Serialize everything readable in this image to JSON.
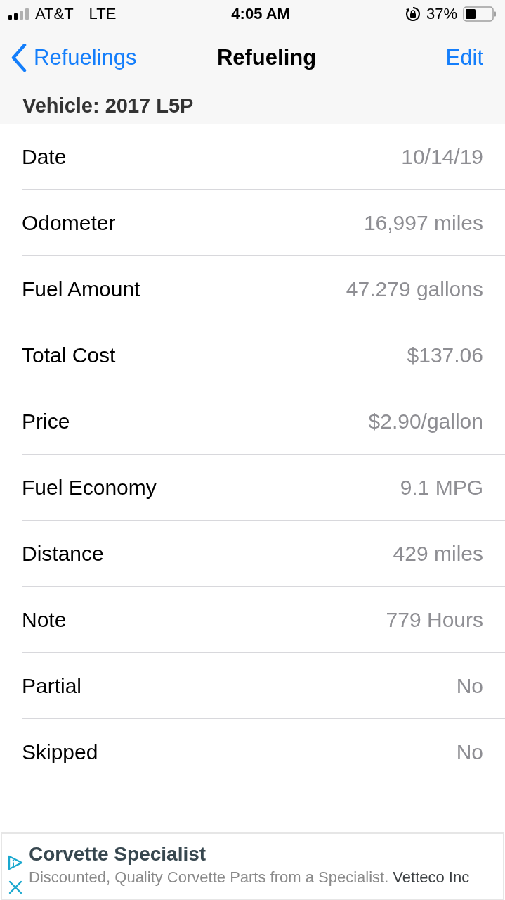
{
  "status_bar": {
    "carrier": "AT&T",
    "network": "LTE",
    "time": "4:05 AM",
    "battery_percent": "37%"
  },
  "nav_bar": {
    "back_label": "Refuelings",
    "title": "Refueling",
    "action": "Edit"
  },
  "section_header": "Vehicle: 2017 L5P",
  "rows": [
    {
      "label": "Date",
      "value": "10/14/19"
    },
    {
      "label": "Odometer",
      "value": "16,997 miles"
    },
    {
      "label": "Fuel Amount",
      "value": "47.279 gallons"
    },
    {
      "label": "Total Cost",
      "value": "$137.06"
    },
    {
      "label": "Price",
      "value": "$2.90/gallon"
    },
    {
      "label": "Fuel Economy",
      "value": "9.1 MPG"
    },
    {
      "label": "Distance",
      "value": "429 miles"
    },
    {
      "label": "Note",
      "value": "779 Hours"
    },
    {
      "label": "Partial",
      "value": "No"
    },
    {
      "label": "Skipped",
      "value": "No"
    }
  ],
  "ad": {
    "title": "Corvette Specialist",
    "description": "Discounted, Quality Corvette Parts from a Specialist.",
    "advertiser": "Vetteco Inc"
  }
}
